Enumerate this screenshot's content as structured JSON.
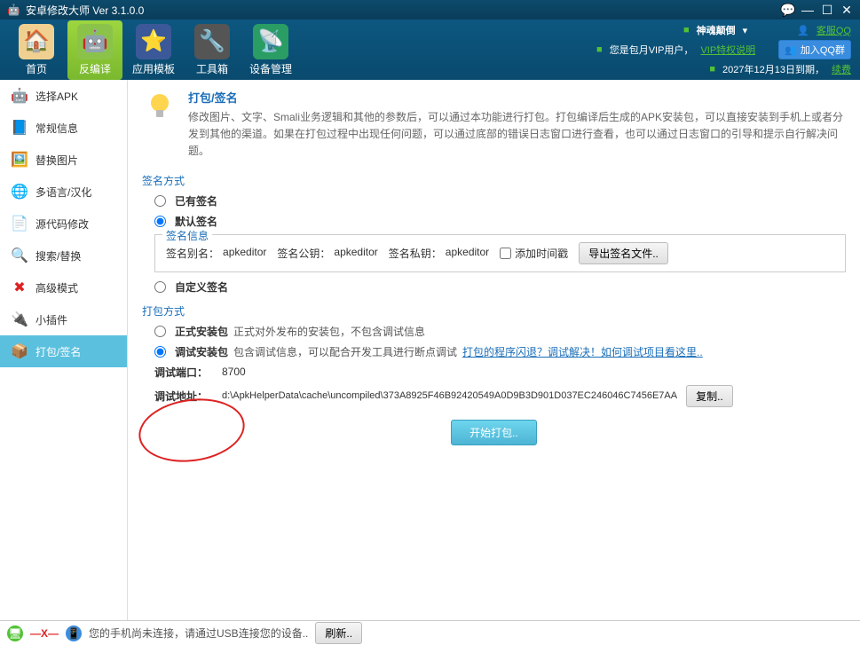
{
  "title": "安卓修改大师 Ver 3.1.0.0",
  "window_controls": {
    "chat": "💬",
    "min": "—",
    "max": "☐",
    "close": "✕"
  },
  "nav": [
    {
      "label": "首页",
      "icon": "🏠",
      "bg": "#e8a94a"
    },
    {
      "label": "反编译",
      "icon": "🤖",
      "bg": "#8bc34a",
      "active": true
    },
    {
      "label": "应用模板",
      "icon": "⭐",
      "bg": "#3b5998"
    },
    {
      "label": "工具箱",
      "icon": "🔧",
      "bg": "#555"
    },
    {
      "label": "设备管理",
      "icon": "📡",
      "bg": "#2a9d64"
    }
  ],
  "header_right": {
    "line1_name": "神魂颠倒",
    "line2_prefix": "您是包月VIP用户，",
    "line2_link": "VIP特权说明",
    "line3_prefix": "2027年12月13日到期，",
    "line3_link": "续费",
    "qq_label": "客服QQ",
    "qq_btn": "加入QQ群"
  },
  "sidebar": [
    {
      "label": "选择APK",
      "icon": "🤖",
      "color": "#8bc34a"
    },
    {
      "label": "常规信息",
      "icon": "📘",
      "color": "#3a8dde"
    },
    {
      "label": "替换图片",
      "icon": "🖼️",
      "color": "#e67e22"
    },
    {
      "label": "多语言/汉化",
      "icon": "🌐",
      "color": "#2a9d64"
    },
    {
      "label": "源代码修改",
      "icon": "📄",
      "color": "#555"
    },
    {
      "label": "搜索/替换",
      "icon": "🔍",
      "color": "#e6b84a"
    },
    {
      "label": "高级模式",
      "icon": "✖",
      "color": "#d22"
    },
    {
      "label": "小插件",
      "icon": "🔌",
      "color": "#3a8dde"
    },
    {
      "label": "打包/签名",
      "icon": "📦",
      "color": "#e6a84a",
      "active": true
    }
  ],
  "info": {
    "title": "打包/签名",
    "desc": "修改图片、文字、Smali业务逻辑和其他的参数后，可以通过本功能进行打包。打包编译后生成的APK安装包，可以直接安装到手机上或者分发到其他的渠道。如果在打包过程中出现任何问题，可以通过底部的错误日志窗口进行查看，也可以通过日志窗口的引导和提示自行解决问题。"
  },
  "sign": {
    "section": "签名方式",
    "opt_existing": "已有签名",
    "opt_default": "默认签名",
    "legend": "签名信息",
    "alias_k": "签名别名：",
    "alias_v": "apkeditor",
    "pubkey_k": "签名公钥：",
    "pubkey_v": "apkeditor",
    "prikey_k": "签名私钥：",
    "prikey_v": "apkeditor",
    "add_ts": "添加时间戳",
    "export_btn": "导出签名文件..",
    "opt_custom": "自定义签名"
  },
  "pack": {
    "section": "打包方式",
    "opt_release": "正式安装包",
    "opt_release_desc": "正式对外发布的安装包，不包含调试信息",
    "opt_debug": "调试安装包",
    "opt_debug_desc": "包含调试信息，可以配合开发工具进行断点调试",
    "debug_link": "打包的程序闪退？调试解决！如何调试项目看这里..",
    "port_k": "调试端口：",
    "port_v": "8700",
    "addr_k": "调试地址：",
    "addr_v": "d:\\ApkHelperData\\cache\\uncompiled\\373A8925F46B92420549A0D9B3D901D037EC246046C7456E7AA",
    "copy_btn": "复制..",
    "start_btn": "开始打包.."
  },
  "status": {
    "msg": "您的手机尚未连接，请通过USB连接您的设备..",
    "refresh": "刷新.."
  }
}
